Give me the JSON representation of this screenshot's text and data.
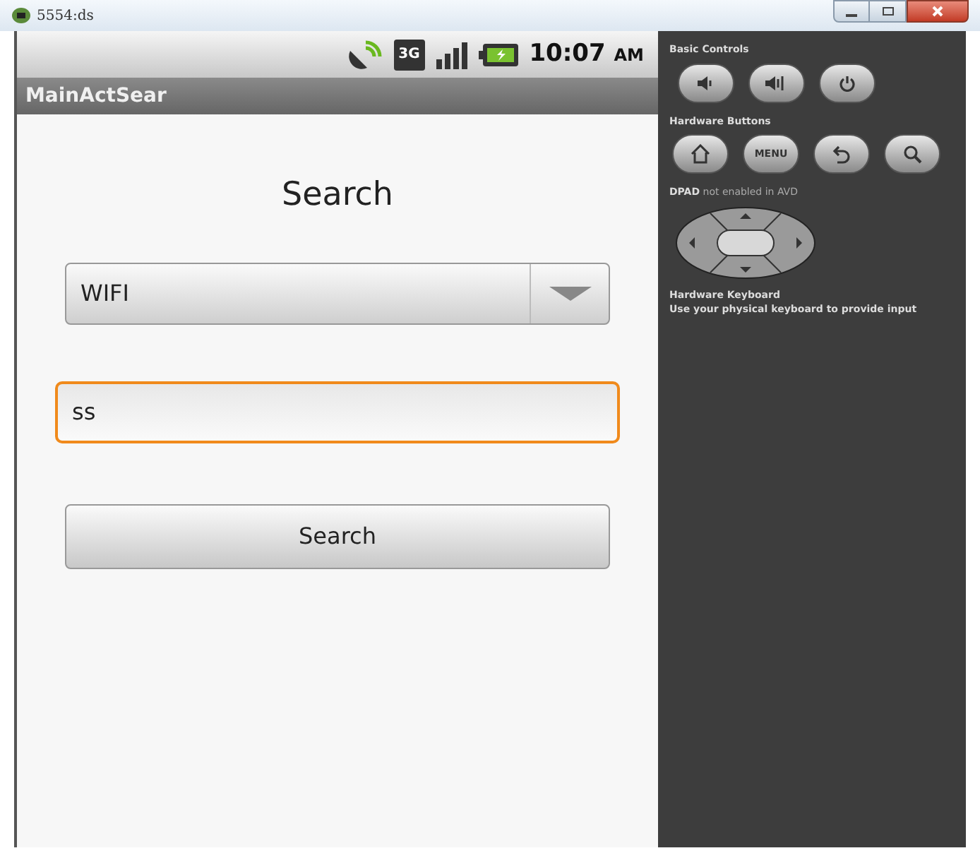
{
  "window": {
    "title": "5554:ds"
  },
  "status_bar": {
    "network_type": "3G",
    "time": "10:07",
    "am_pm": "AM"
  },
  "app": {
    "title": "MainActSear",
    "heading": "Search",
    "spinner": {
      "value": "WIFI"
    },
    "field": {
      "value": "ss",
      "focused": true
    },
    "button": "Search"
  },
  "controls": {
    "basic_title": "Basic Controls",
    "hardware_title": "Hardware Buttons",
    "menu_label": "MENU",
    "dpad_bold": "DPAD",
    "dpad_note": "not enabled in AVD",
    "keyboard_title": "Hardware Keyboard",
    "keyboard_note": "Use your physical keyboard to provide input"
  }
}
